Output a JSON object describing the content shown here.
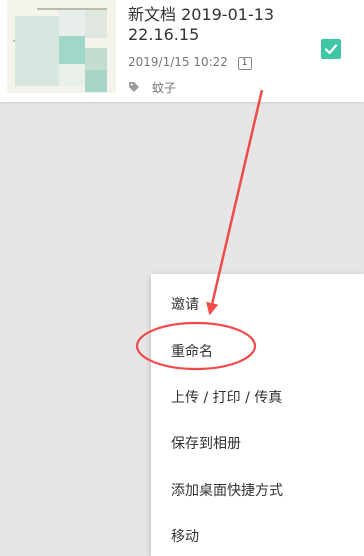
{
  "document": {
    "title": "新文档 2019-01-13 22.16.15",
    "date": "2019/1/15 10:22",
    "page_count": "1",
    "tag": "蚊子",
    "selected": true,
    "tag_icon": "tag-icon",
    "check_icon": "checkmark-icon",
    "check_color": "#3ec6a7"
  },
  "context_menu": {
    "items": [
      "邀请",
      "重命名",
      "上传 / 打印 / 传真",
      "保存到相册",
      "添加桌面快捷方式",
      "移动"
    ]
  },
  "annotation": {
    "color": "#f04a4a",
    "highlighted_item": "重命名"
  }
}
